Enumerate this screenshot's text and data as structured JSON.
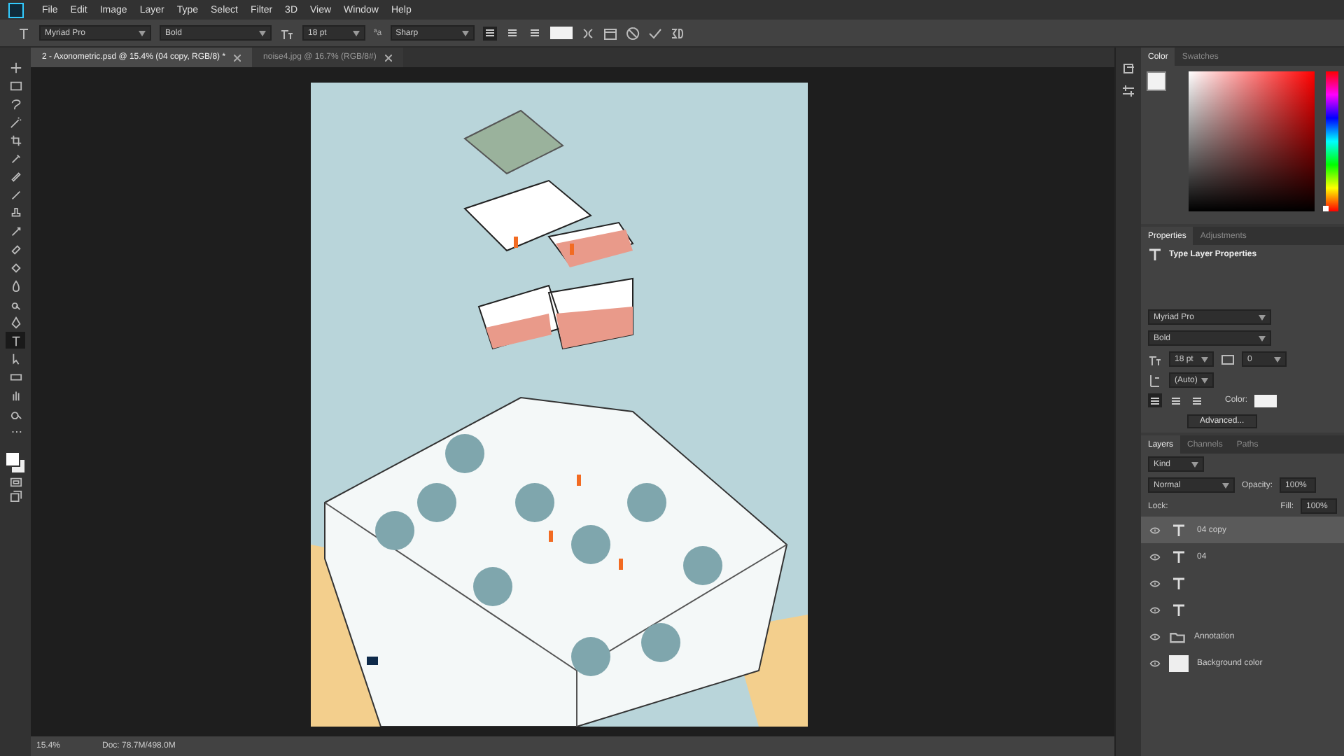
{
  "menu": [
    "File",
    "Edit",
    "Image",
    "Layer",
    "Type",
    "Select",
    "Filter",
    "3D",
    "View",
    "Window",
    "Help"
  ],
  "options": {
    "font": "Myriad Pro",
    "style": "Bold",
    "size": "18 pt",
    "aa_symbol": "ªa",
    "antialias": "Sharp",
    "align": [
      {
        "selected": true
      },
      {
        "selected": false
      },
      {
        "selected": false
      }
    ]
  },
  "doc_tabs": [
    {
      "label": "2 - Axonometric.psd @ 15.4% (04 copy, RGB/8) *",
      "selected": true
    },
    {
      "label": "noise4.jpg @ 16.7% (RGB/8#)",
      "selected": false
    }
  ],
  "tools": [
    {
      "kind": "move",
      "selected": false
    },
    {
      "kind": "marquee",
      "selected": false
    },
    {
      "kind": "lasso",
      "selected": false
    },
    {
      "kind": "wand",
      "selected": false
    },
    {
      "kind": "crop",
      "selected": false
    },
    {
      "kind": "eyedropper",
      "selected": false
    },
    {
      "kind": "heal",
      "selected": false
    },
    {
      "kind": "brush",
      "selected": false
    },
    {
      "kind": "stamp",
      "selected": false
    },
    {
      "kind": "history",
      "selected": false
    },
    {
      "kind": "eraser",
      "selected": false
    },
    {
      "kind": "bucket",
      "selected": false
    },
    {
      "kind": "blur",
      "selected": false
    },
    {
      "kind": "dodge",
      "selected": false
    },
    {
      "kind": "pen",
      "selected": false
    },
    {
      "kind": "type",
      "selected": true
    },
    {
      "kind": "select",
      "selected": false
    },
    {
      "kind": "shape",
      "selected": false
    },
    {
      "kind": "hand",
      "selected": false
    },
    {
      "kind": "zoom",
      "selected": false
    },
    {
      "kind": "more",
      "selected": false
    }
  ],
  "color_panel": {
    "hue": {
      "level": 0.0
    },
    "tabs": [
      {
        "label": "Color",
        "selected": true
      },
      {
        "label": "Swatches",
        "selected": false
      }
    ]
  },
  "properties": {
    "tabs": [
      {
        "label": "Properties",
        "selected": true
      },
      {
        "label": "Adjustments",
        "selected": false
      }
    ],
    "title": "Type Layer Properties",
    "font": "Myriad Pro",
    "style": "Bold",
    "size": "18 pt",
    "tracking": "0",
    "leading": "(Auto)",
    "color_label": "Color:",
    "advanced": "Advanced..."
  },
  "layers_panel": {
    "tabs": [
      {
        "label": "Layers",
        "selected": true
      },
      {
        "label": "Channels",
        "selected": false
      },
      {
        "label": "Paths",
        "selected": false
      }
    ],
    "kind_filter": "Kind",
    "blend": "Normal",
    "opacity_label": "Opacity:",
    "opacity": "100%",
    "lock_label": "Lock:",
    "fill_label": "Fill:",
    "fill": "100%",
    "layers": [
      {
        "kind": "text",
        "name": "04 copy",
        "selected": true
      },
      {
        "kind": "text",
        "name": "04",
        "selected": false
      },
      {
        "kind": "text",
        "selected": false
      },
      {
        "kind": "text",
        "selected": false
      },
      {
        "kind": "group",
        "name": "Annotation",
        "selected": false
      },
      {
        "kind": "pixel",
        "name": "Background color",
        "selected": false
      }
    ]
  },
  "status_bar": {
    "zoom": "15.4%",
    "doc": "Doc: 78.7M/498.0M"
  }
}
